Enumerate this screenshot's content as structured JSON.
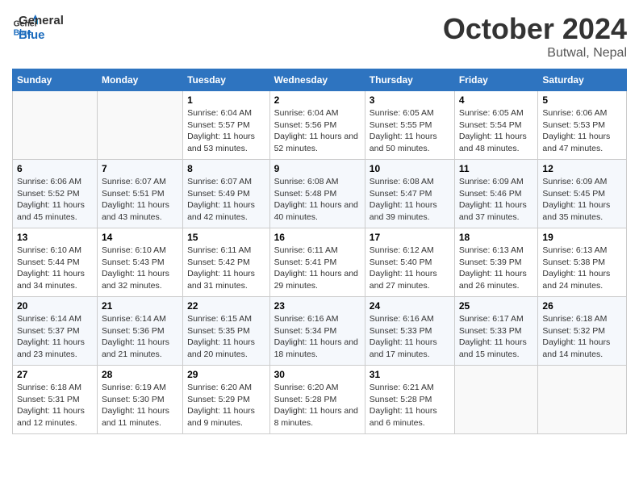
{
  "header": {
    "logo_line1": "General",
    "logo_line2": "Blue",
    "month": "October 2024",
    "location": "Butwal, Nepal"
  },
  "days_of_week": [
    "Sunday",
    "Monday",
    "Tuesday",
    "Wednesday",
    "Thursday",
    "Friday",
    "Saturday"
  ],
  "weeks": [
    [
      {
        "num": "",
        "info": ""
      },
      {
        "num": "",
        "info": ""
      },
      {
        "num": "1",
        "info": "Sunrise: 6:04 AM\nSunset: 5:57 PM\nDaylight: 11 hours and 53 minutes."
      },
      {
        "num": "2",
        "info": "Sunrise: 6:04 AM\nSunset: 5:56 PM\nDaylight: 11 hours and 52 minutes."
      },
      {
        "num": "3",
        "info": "Sunrise: 6:05 AM\nSunset: 5:55 PM\nDaylight: 11 hours and 50 minutes."
      },
      {
        "num": "4",
        "info": "Sunrise: 6:05 AM\nSunset: 5:54 PM\nDaylight: 11 hours and 48 minutes."
      },
      {
        "num": "5",
        "info": "Sunrise: 6:06 AM\nSunset: 5:53 PM\nDaylight: 11 hours and 47 minutes."
      }
    ],
    [
      {
        "num": "6",
        "info": "Sunrise: 6:06 AM\nSunset: 5:52 PM\nDaylight: 11 hours and 45 minutes."
      },
      {
        "num": "7",
        "info": "Sunrise: 6:07 AM\nSunset: 5:51 PM\nDaylight: 11 hours and 43 minutes."
      },
      {
        "num": "8",
        "info": "Sunrise: 6:07 AM\nSunset: 5:49 PM\nDaylight: 11 hours and 42 minutes."
      },
      {
        "num": "9",
        "info": "Sunrise: 6:08 AM\nSunset: 5:48 PM\nDaylight: 11 hours and 40 minutes."
      },
      {
        "num": "10",
        "info": "Sunrise: 6:08 AM\nSunset: 5:47 PM\nDaylight: 11 hours and 39 minutes."
      },
      {
        "num": "11",
        "info": "Sunrise: 6:09 AM\nSunset: 5:46 PM\nDaylight: 11 hours and 37 minutes."
      },
      {
        "num": "12",
        "info": "Sunrise: 6:09 AM\nSunset: 5:45 PM\nDaylight: 11 hours and 35 minutes."
      }
    ],
    [
      {
        "num": "13",
        "info": "Sunrise: 6:10 AM\nSunset: 5:44 PM\nDaylight: 11 hours and 34 minutes."
      },
      {
        "num": "14",
        "info": "Sunrise: 6:10 AM\nSunset: 5:43 PM\nDaylight: 11 hours and 32 minutes."
      },
      {
        "num": "15",
        "info": "Sunrise: 6:11 AM\nSunset: 5:42 PM\nDaylight: 11 hours and 31 minutes."
      },
      {
        "num": "16",
        "info": "Sunrise: 6:11 AM\nSunset: 5:41 PM\nDaylight: 11 hours and 29 minutes."
      },
      {
        "num": "17",
        "info": "Sunrise: 6:12 AM\nSunset: 5:40 PM\nDaylight: 11 hours and 27 minutes."
      },
      {
        "num": "18",
        "info": "Sunrise: 6:13 AM\nSunset: 5:39 PM\nDaylight: 11 hours and 26 minutes."
      },
      {
        "num": "19",
        "info": "Sunrise: 6:13 AM\nSunset: 5:38 PM\nDaylight: 11 hours and 24 minutes."
      }
    ],
    [
      {
        "num": "20",
        "info": "Sunrise: 6:14 AM\nSunset: 5:37 PM\nDaylight: 11 hours and 23 minutes."
      },
      {
        "num": "21",
        "info": "Sunrise: 6:14 AM\nSunset: 5:36 PM\nDaylight: 11 hours and 21 minutes."
      },
      {
        "num": "22",
        "info": "Sunrise: 6:15 AM\nSunset: 5:35 PM\nDaylight: 11 hours and 20 minutes."
      },
      {
        "num": "23",
        "info": "Sunrise: 6:16 AM\nSunset: 5:34 PM\nDaylight: 11 hours and 18 minutes."
      },
      {
        "num": "24",
        "info": "Sunrise: 6:16 AM\nSunset: 5:33 PM\nDaylight: 11 hours and 17 minutes."
      },
      {
        "num": "25",
        "info": "Sunrise: 6:17 AM\nSunset: 5:33 PM\nDaylight: 11 hours and 15 minutes."
      },
      {
        "num": "26",
        "info": "Sunrise: 6:18 AM\nSunset: 5:32 PM\nDaylight: 11 hours and 14 minutes."
      }
    ],
    [
      {
        "num": "27",
        "info": "Sunrise: 6:18 AM\nSunset: 5:31 PM\nDaylight: 11 hours and 12 minutes."
      },
      {
        "num": "28",
        "info": "Sunrise: 6:19 AM\nSunset: 5:30 PM\nDaylight: 11 hours and 11 minutes."
      },
      {
        "num": "29",
        "info": "Sunrise: 6:20 AM\nSunset: 5:29 PM\nDaylight: 11 hours and 9 minutes."
      },
      {
        "num": "30",
        "info": "Sunrise: 6:20 AM\nSunset: 5:28 PM\nDaylight: 11 hours and 8 minutes."
      },
      {
        "num": "31",
        "info": "Sunrise: 6:21 AM\nSunset: 5:28 PM\nDaylight: 11 hours and 6 minutes."
      },
      {
        "num": "",
        "info": ""
      },
      {
        "num": "",
        "info": ""
      }
    ]
  ]
}
